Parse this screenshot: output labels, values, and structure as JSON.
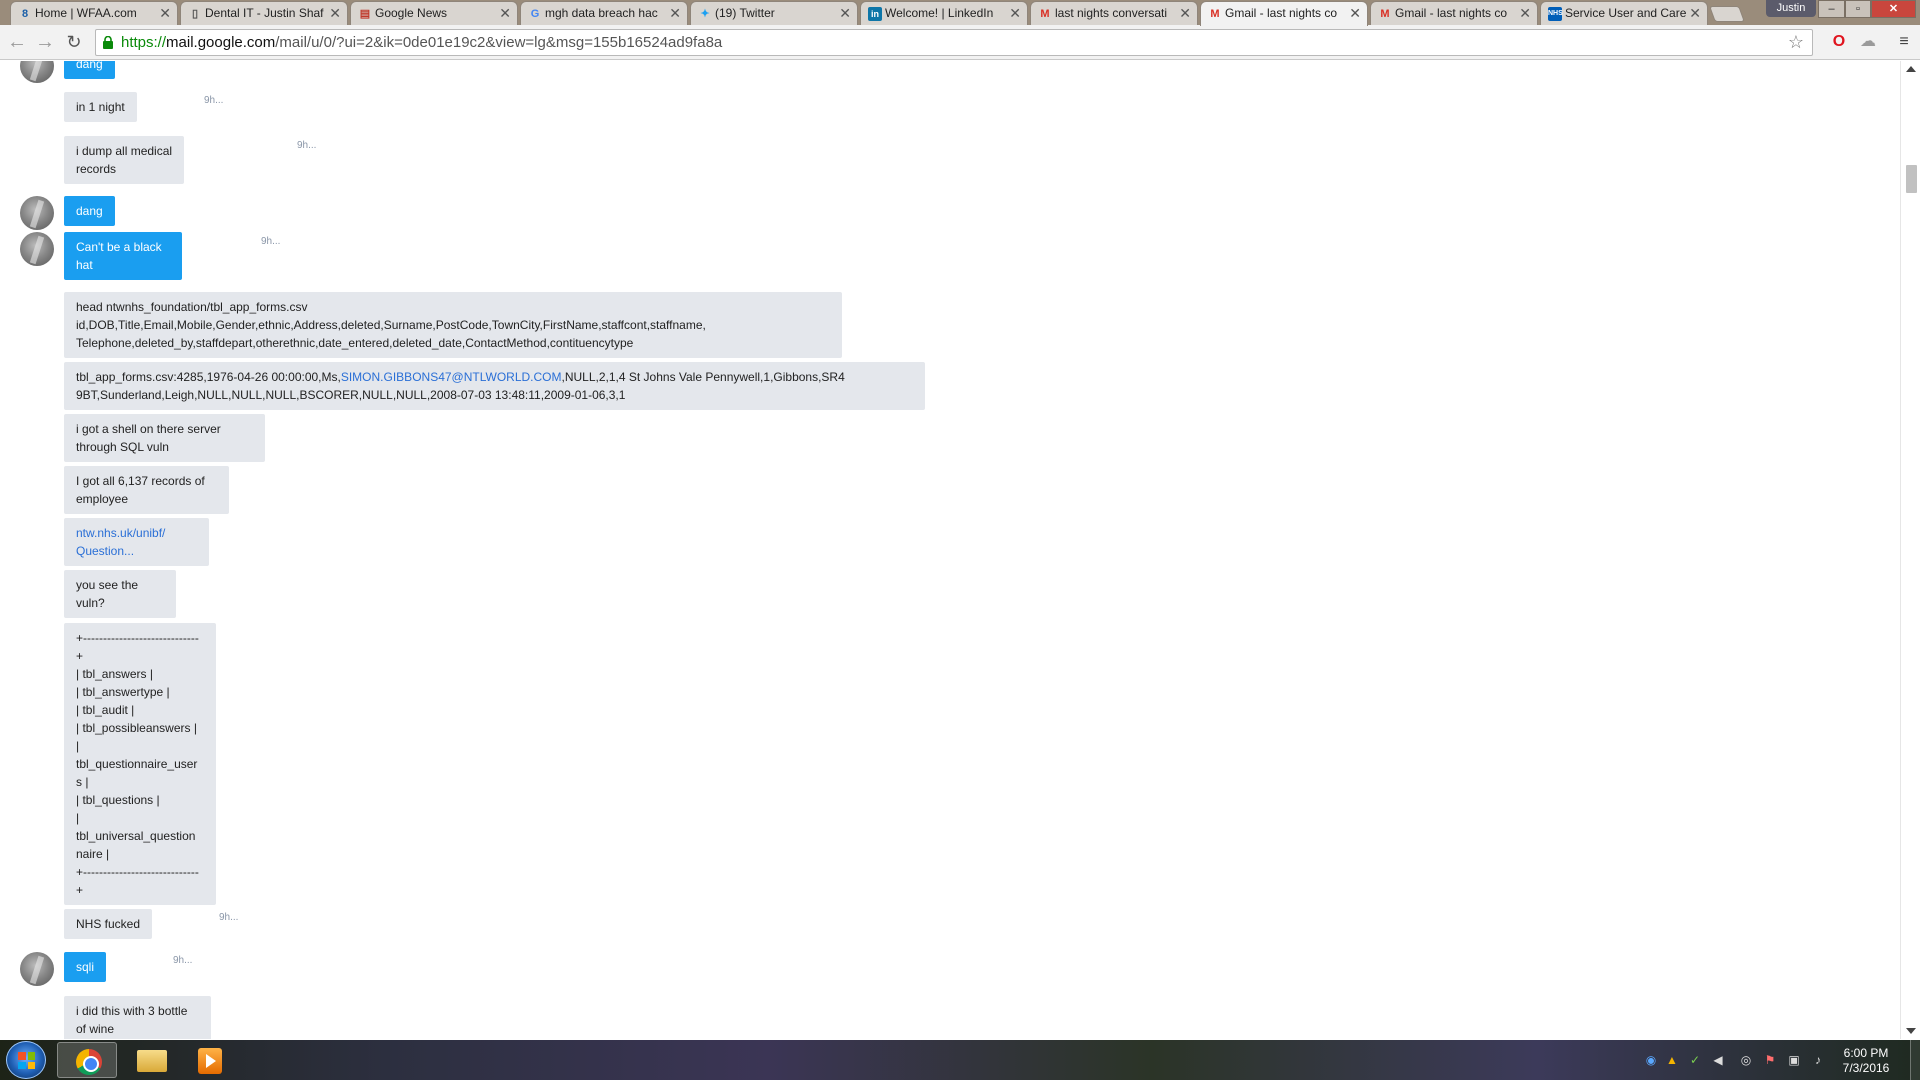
{
  "browser": {
    "tabs": [
      {
        "title": "Home | WFAA.com",
        "icon": "wfaa-icon",
        "glyph": "8",
        "color": "#1b5fa8"
      },
      {
        "title": "Dental IT - Justin Shaf",
        "icon": "document-icon",
        "glyph": "▯",
        "color": "#555555"
      },
      {
        "title": "Google News",
        "icon": "news-icon",
        "glyph": "▤",
        "color": "#c0392b"
      },
      {
        "title": "mgh data breach hac",
        "icon": "google-icon",
        "glyph": "G",
        "color": "#4285f4"
      },
      {
        "title": "(19) Twitter",
        "icon": "twitter-icon",
        "glyph": "✦",
        "color": "#1da1f2"
      },
      {
        "title": "Welcome! | LinkedIn",
        "icon": "linkedin-icon",
        "glyph": "in",
        "color": "#0e76a8"
      },
      {
        "title": "last nights conversati",
        "icon": "gmail-icon",
        "glyph": "M",
        "color": "#d93025"
      },
      {
        "title": "Gmail - last nights co",
        "icon": "gmail-icon",
        "glyph": "M",
        "color": "#d93025"
      },
      {
        "title": "Gmail - last nights co",
        "icon": "gmail-icon",
        "glyph": "M",
        "color": "#d93025"
      },
      {
        "title": "Service User and Care",
        "icon": "nhs-icon",
        "glyph": "NHS",
        "color": "#005eb8"
      }
    ],
    "active_tab_index": 7,
    "user_badge": "Justin",
    "url": {
      "scheme": "https://",
      "host": "mail.google.com",
      "path": "/mail/u/0/?ui=2&ik=0de01e19c2&view=lg&msg=155b16524ad9fa8a"
    }
  },
  "conversation": {
    "messages": [
      {
        "text": "dang",
        "variant": "blue",
        "avatar": true,
        "timestamp": ""
      },
      {
        "text": "in 1 night",
        "variant": "gray",
        "avatar": false,
        "timestamp": "9h..."
      },
      {
        "text": "i dump all medical\nrecords",
        "variant": "gray",
        "avatar": false,
        "timestamp": "9h..."
      },
      {
        "text": "dang",
        "variant": "blue",
        "avatar": true,
        "timestamp": ""
      },
      {
        "text": "Can't be a black\nhat",
        "variant": "blue",
        "avatar": true,
        "timestamp": "9h..."
      },
      {
        "text": "head ntwnhs_foundation/tbl_app_forms.csv\nid,DOB,Title,Email,Mobile,Gender,ethnic,Address,deleted,Surname,PostCode,TownCity,FirstName,staffcont,staffname,\nTelephone,deleted_by,staffdepart,otherethnic,date_entered,deleted_date,ContactMethod,contituencytype",
        "variant": "gray",
        "avatar": false,
        "timestamp": ""
      },
      {
        "text_before": "tbl_app_forms.csv:4285,1976-04-26 00:00:00,Ms,",
        "link": "SIMON.GIBBONS47@NTLWORLD.COM",
        "text_after": ",NULL,2,1,4 St Johns Vale Pennywell,1,Gibbons,SR4\n9BT,Sunderland,Leigh,NULL,NULL,NULL,BSCORER,NULL,NULL,2008-07-03 13:48:11,2009-01-06,3,1",
        "variant": "gray",
        "avatar": false,
        "timestamp": ""
      },
      {
        "text": "i got a shell on there server\nthrough SQL vuln",
        "variant": "gray",
        "avatar": false,
        "timestamp": ""
      },
      {
        "text": "I got all 6,137 records of\nemployee",
        "variant": "gray",
        "avatar": false,
        "timestamp": ""
      },
      {
        "link": "ntw.nhs.uk/unibf/\nQuestion...",
        "variant": "gray",
        "avatar": false,
        "timestamp": ""
      },
      {
        "text": "you see the\nvuln?",
        "variant": "gray",
        "avatar": false,
        "timestamp": ""
      },
      {
        "text": "+-----------------------------\n+\n| tbl_answers |\n| tbl_answertype |\n| tbl_audit |\n| tbl_possibleanswers |\n|\ntbl_questionnaire_user\ns |\n| tbl_questions |\n|\ntbl_universal_question\nnaire |\n+-----------------------------\n+",
        "variant": "gray",
        "avatar": false,
        "timestamp": ""
      },
      {
        "text": "NHS fucked",
        "variant": "gray",
        "avatar": false,
        "timestamp": "9h..."
      },
      {
        "text": "sqli",
        "variant": "blue",
        "avatar": true,
        "timestamp": "9h..."
      },
      {
        "text": "i did this with 3 bottle\nof wine",
        "variant": "gray",
        "avatar": false,
        "timestamp": ""
      }
    ]
  },
  "taskbar": {
    "apps": [
      {
        "name": "chrome",
        "active": true
      },
      {
        "name": "file-explorer",
        "active": false
      },
      {
        "name": "media-player",
        "active": false
      }
    ],
    "clock_time": "6:00 PM",
    "clock_date": "7/3/2016"
  }
}
